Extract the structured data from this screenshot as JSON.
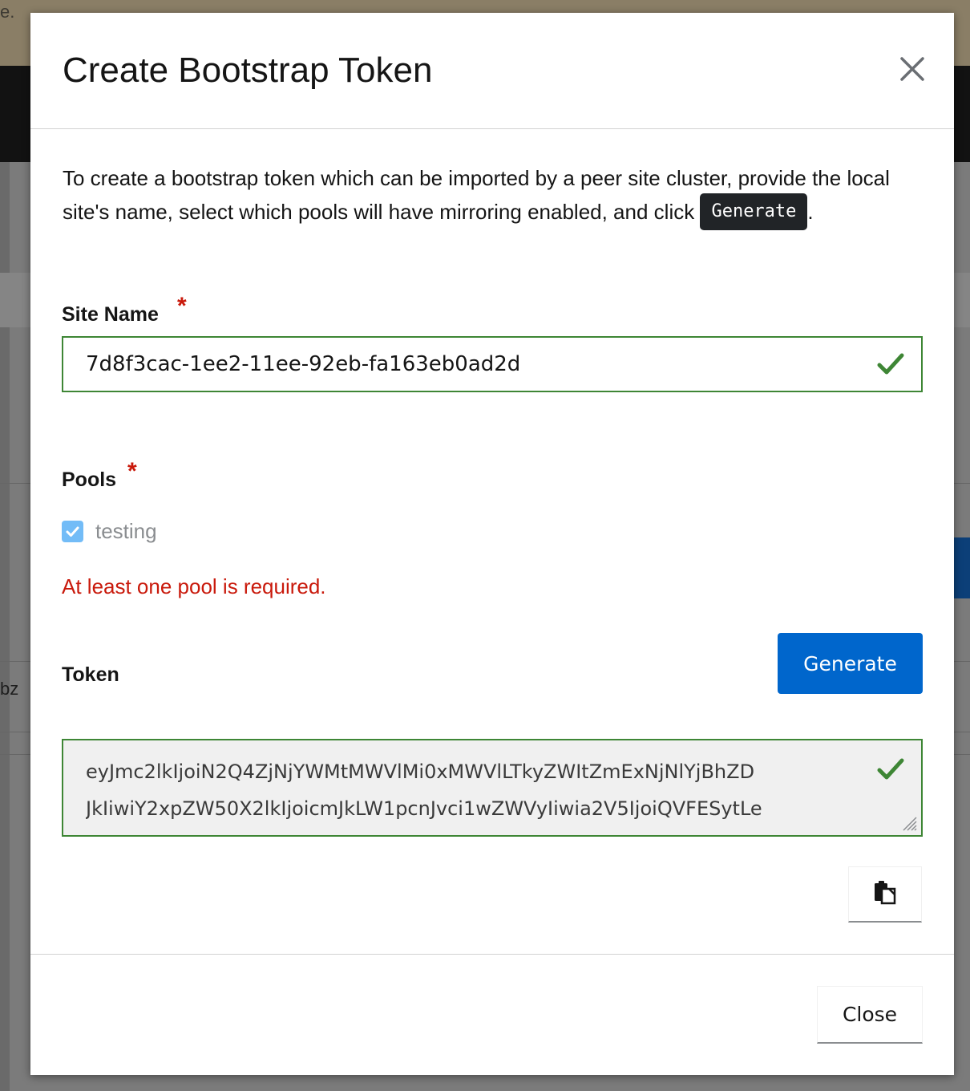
{
  "background": {
    "topbar_fragment": "e.",
    "table_fragment": "bz"
  },
  "modal": {
    "title": "Create Bootstrap Token",
    "close_icon": "close-x-icon",
    "intro_text": "To create a bootstrap token which can be imported by a peer site cluster, provide the local site's name, select which pools will have mirroring enabled, and click",
    "intro_code": "Generate",
    "intro_end": ".",
    "site_name": {
      "label": "Site Name",
      "required_mark": "*",
      "value": "7d8f3cac-1ee2-11ee-92eb-fa163eb0ad2d",
      "status": "valid",
      "status_icon": "check-icon"
    },
    "pools": {
      "label": "Pools",
      "required_mark": "*",
      "items": [
        {
          "name": "testing",
          "checked": true,
          "disabled": true
        }
      ],
      "error": "At least one pool is required."
    },
    "token": {
      "label": "Token",
      "generate_label": "Generate",
      "value": "eyJmc2lkIjoiN2Q4ZjNjYWMtMWVlMi0xMWVlLTkyZWItZmExNjNlYjBhZD\nJkIiwiY2xpZW50X2lkIjoicmJkLW1pcnJvci1wZWVyIiwia2V5IjoiQVFESytLe",
      "status_icon": "check-icon",
      "copy_icon": "clipboard-icon"
    },
    "footer": {
      "close_label": "Close"
    }
  },
  "colors": {
    "primary": "#0066cc",
    "success": "#3e8635",
    "danger": "#c9190b",
    "code_bg": "#212427",
    "checkbox_disabled": "#73bcf7"
  }
}
